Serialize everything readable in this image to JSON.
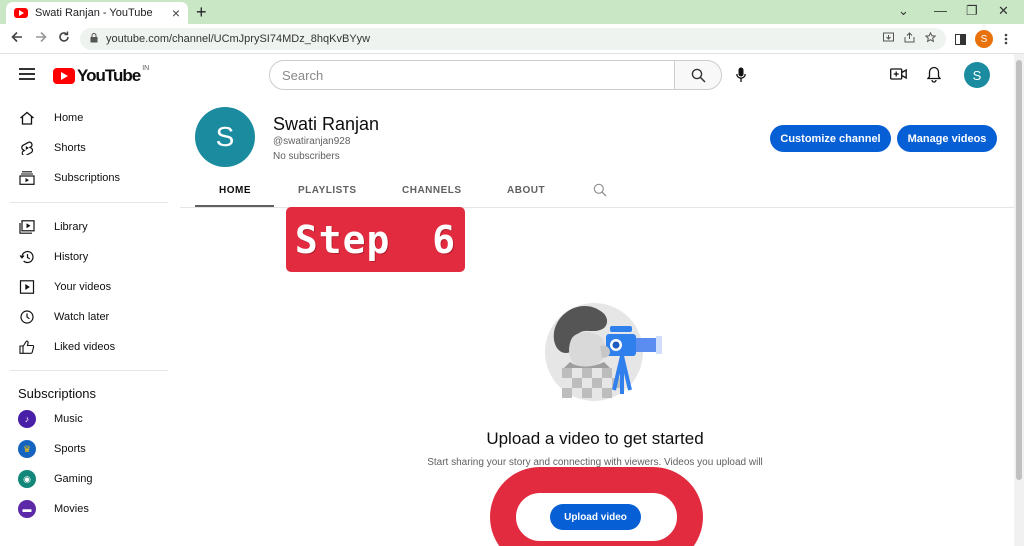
{
  "browser": {
    "tab_title": "Swati Ranjan - YouTube",
    "tab_close": "×",
    "new_tab": "+",
    "url": "youtube.com/channel/UCmJprySI74MDz_8hqKvBYyw",
    "profile_initial": "S",
    "window_controls": [
      "⌄",
      "—",
      "❐",
      "✕"
    ]
  },
  "youtube": {
    "logo_text": "YouTube",
    "country_code": "IN",
    "search_placeholder": "Search",
    "account_initial": "S"
  },
  "sidebar": {
    "items": [
      {
        "label": "Home",
        "icon": "home-icon"
      },
      {
        "label": "Shorts",
        "icon": "shorts-icon"
      },
      {
        "label": "Subscriptions",
        "icon": "subscriptions-icon"
      },
      {
        "label": "Library",
        "icon": "library-icon"
      },
      {
        "label": "History",
        "icon": "history-icon"
      },
      {
        "label": "Your videos",
        "icon": "your-videos-icon"
      },
      {
        "label": "Watch later",
        "icon": "watch-later-icon"
      },
      {
        "label": "Liked videos",
        "icon": "like-icon"
      }
    ],
    "subscriptions_heading": "Subscriptions",
    "subscriptions": [
      {
        "label": "Music",
        "color": "#4a1fa8"
      },
      {
        "label": "Sports",
        "color": "#1565c0"
      },
      {
        "label": "Gaming",
        "color": "#12877a"
      },
      {
        "label": "Movies",
        "color": "#5c2aa8"
      }
    ]
  },
  "channel": {
    "avatar_initial": "S",
    "name": "Swati Ranjan",
    "handle": "@swatiranjan928",
    "subscribers": "No subscribers",
    "customize_label": "Customize channel",
    "manage_label": "Manage videos",
    "tabs": [
      "HOME",
      "PLAYLISTS",
      "CHANNELS",
      "ABOUT"
    ],
    "active_tab": "HOME"
  },
  "overlay": {
    "step_label": "Step 6",
    "accent_color": "#e22b3f"
  },
  "empty_state": {
    "title": "Upload a video to get started",
    "description": "Start sharing your story and connecting with viewers. Videos you upload will",
    "upload_label": "Upload video"
  },
  "colors": {
    "brand_red": "#ff0000",
    "button_blue": "#065fd4",
    "avatar_teal": "#1b8ba0"
  }
}
